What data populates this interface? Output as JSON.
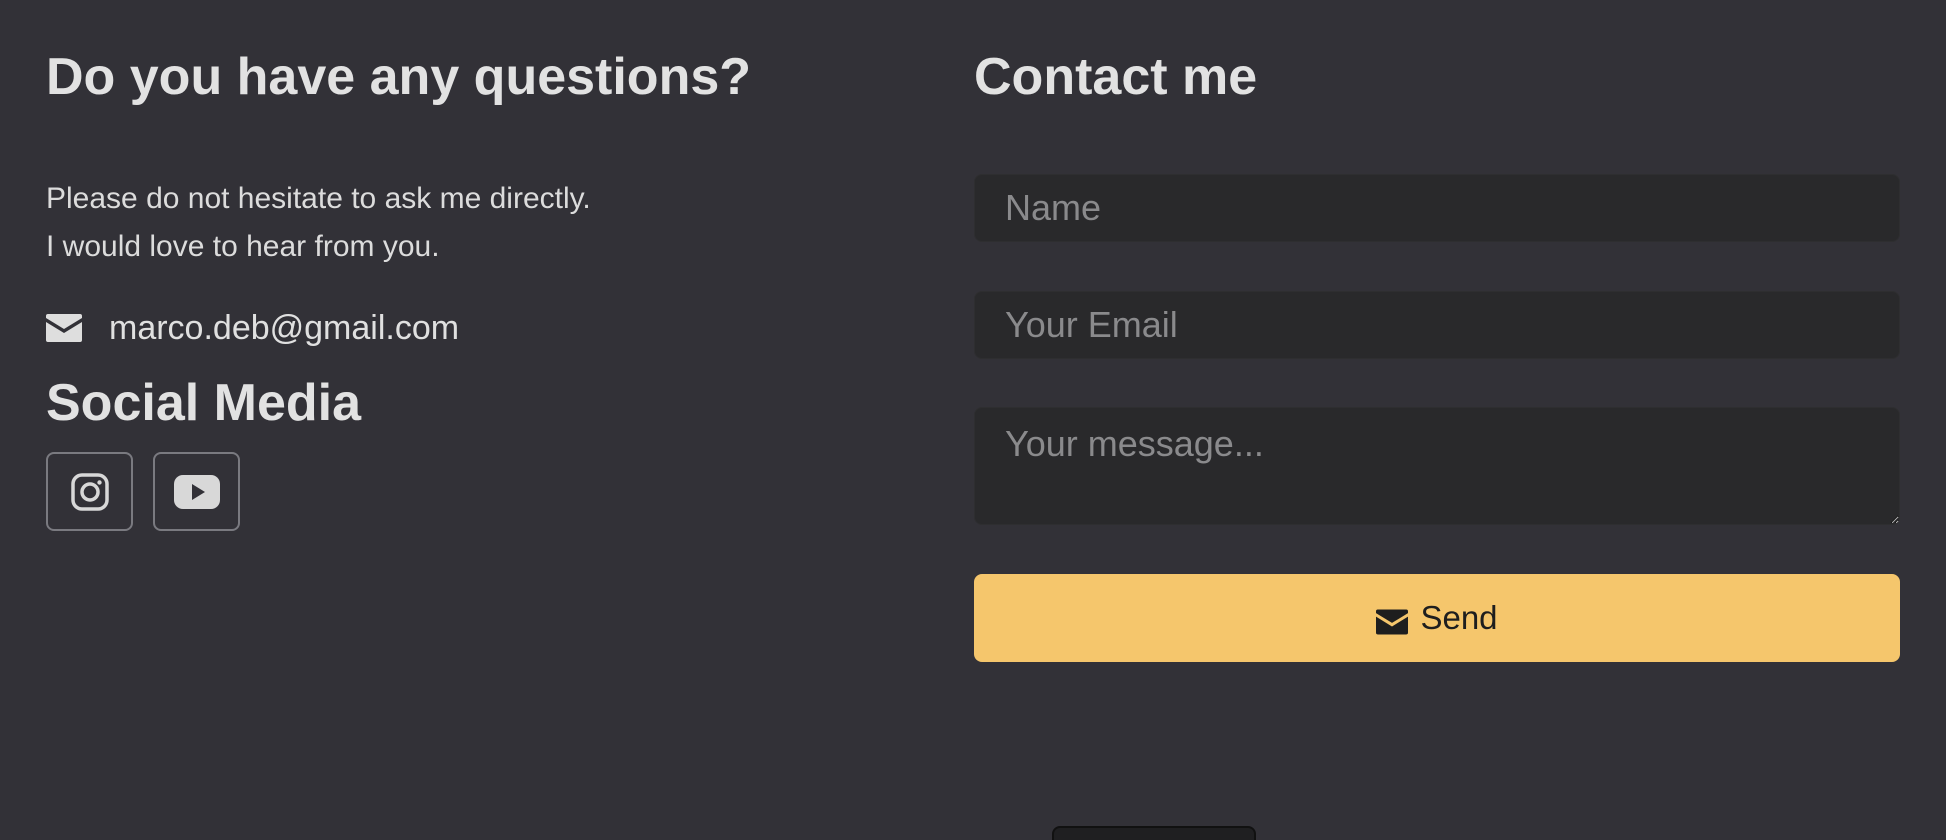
{
  "left": {
    "questions_title": "Do you have any questions?",
    "intro_line1": "Please do not hesitate to ask me directly.",
    "intro_line2": "I would love to hear from you.",
    "email": "marco.deb@gmail.com",
    "email_icon": "envelope-icon",
    "social_title": "Social Media",
    "social_links": [
      {
        "icon": "instagram-icon"
      },
      {
        "icon": "youtube-icon"
      }
    ]
  },
  "contact": {
    "title": "Contact me",
    "name_placeholder": "Name",
    "email_placeholder": "Your Email",
    "message_placeholder": "Your message...",
    "send_label": "Send",
    "send_icon": "envelope-icon"
  },
  "colors": {
    "background": "#323137",
    "field_background": "#29292b",
    "accent": "#f5c66c",
    "text": "#e2e2e2",
    "placeholder": "#8a8a8c"
  }
}
